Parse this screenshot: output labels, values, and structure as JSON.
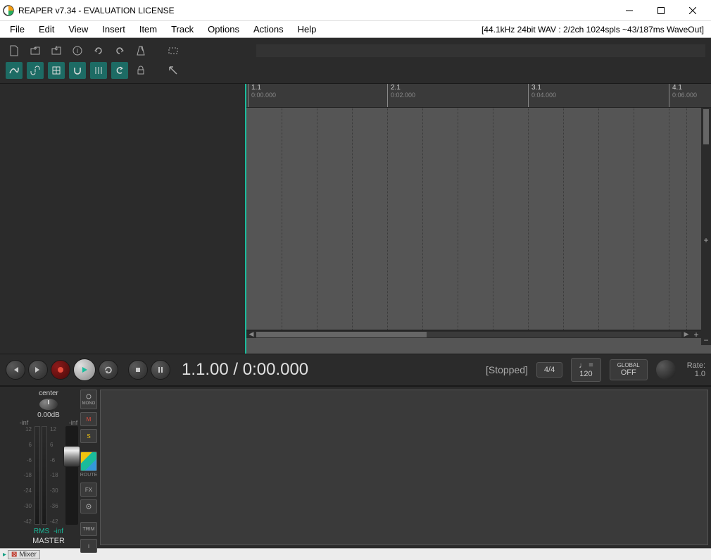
{
  "window": {
    "title": "REAPER v7.34 - EVALUATION LICENSE"
  },
  "menu": {
    "items": [
      "File",
      "Edit",
      "View",
      "Insert",
      "Item",
      "Track",
      "Options",
      "Actions",
      "Help"
    ],
    "audio_info": "[44.1kHz 24bit WAV : 2/2ch 1024spls ~43/187ms WaveOut]"
  },
  "ruler": [
    {
      "bar": "1.1",
      "time": "0:00.000",
      "pos": 0
    },
    {
      "bar": "2.1",
      "time": "0:02.000",
      "pos": 200
    },
    {
      "bar": "3.1",
      "time": "0:04.000",
      "pos": 400
    },
    {
      "bar": "4.1",
      "time": "0:06.000",
      "pos": 600
    }
  ],
  "transport": {
    "time": "1.1.00 / 0:00.000",
    "status": "[Stopped]",
    "timesig": "4/4",
    "bpm_note": "♩ =",
    "bpm": "120",
    "global_label": "GLOBAL",
    "global_mode": "OFF",
    "rate_label": "Rate:",
    "rate": "1.0"
  },
  "master": {
    "center": "center",
    "db": "0.00dB",
    "inf_l": "-inf",
    "inf_r": "-inf",
    "scale_left": [
      "12",
      "6",
      "-6",
      "-18",
      "-24",
      "-30",
      "-42"
    ],
    "scale_right": [
      "12",
      "6",
      "-6",
      "-18",
      "-30",
      "-36",
      "-42"
    ],
    "rms": "RMS",
    "rms_val": "-inf",
    "label": "MASTER",
    "mono": "MONO",
    "m": "M",
    "s": "S",
    "route": "ROUTE",
    "fx": "FX",
    "trim": "TRIM",
    "info": "i"
  },
  "statusbar": {
    "mixer": "Mixer"
  }
}
